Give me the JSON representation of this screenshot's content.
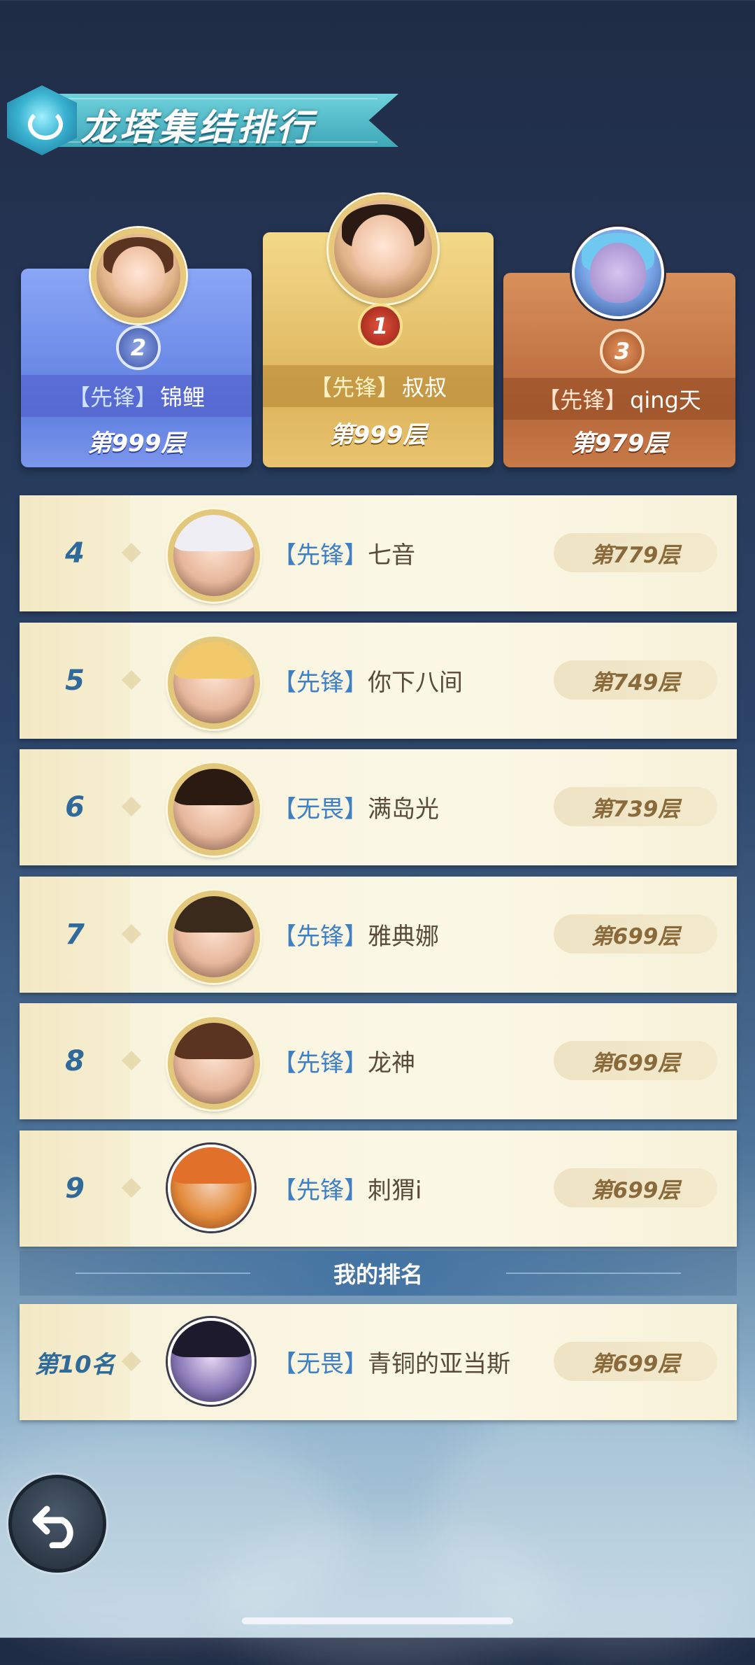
{
  "header": {
    "title": "龙塔集结排行"
  },
  "top3": [
    {
      "rank": "2",
      "tag": "【先锋】",
      "name": "锦鲤",
      "floor": "第999层"
    },
    {
      "rank": "1",
      "tag": "【先锋】",
      "name": "叔叔",
      "floor": "第999层"
    },
    {
      "rank": "3",
      "tag": "【先锋】",
      "name": "qing天",
      "floor": "第979层"
    }
  ],
  "list": [
    {
      "rank": "4",
      "tag": "【先锋】",
      "name": "七音",
      "floor": "第779层"
    },
    {
      "rank": "5",
      "tag": "【先锋】",
      "name": "你下八间",
      "floor": "第749层"
    },
    {
      "rank": "6",
      "tag": "【无畏】",
      "name": "满岛光",
      "floor": "第739层"
    },
    {
      "rank": "7",
      "tag": "【先锋】",
      "name": "雅典娜",
      "floor": "第699层"
    },
    {
      "rank": "8",
      "tag": "【先锋】",
      "name": "龙神",
      "floor": "第699层"
    },
    {
      "rank": "9",
      "tag": "【先锋】",
      "name": "刺猬i",
      "floor": "第699层"
    }
  ],
  "my_section": {
    "label": "我的排名"
  },
  "my_rank": {
    "rank": "第10名",
    "tag": "【无畏】",
    "name": "青铜的亚当斯",
    "floor": "第699层"
  },
  "colors": {
    "gold": "#dcb45b",
    "silver_blue": "#6f8de6",
    "bronze": "#c07040",
    "tag_blue": "#3f7fc4"
  }
}
